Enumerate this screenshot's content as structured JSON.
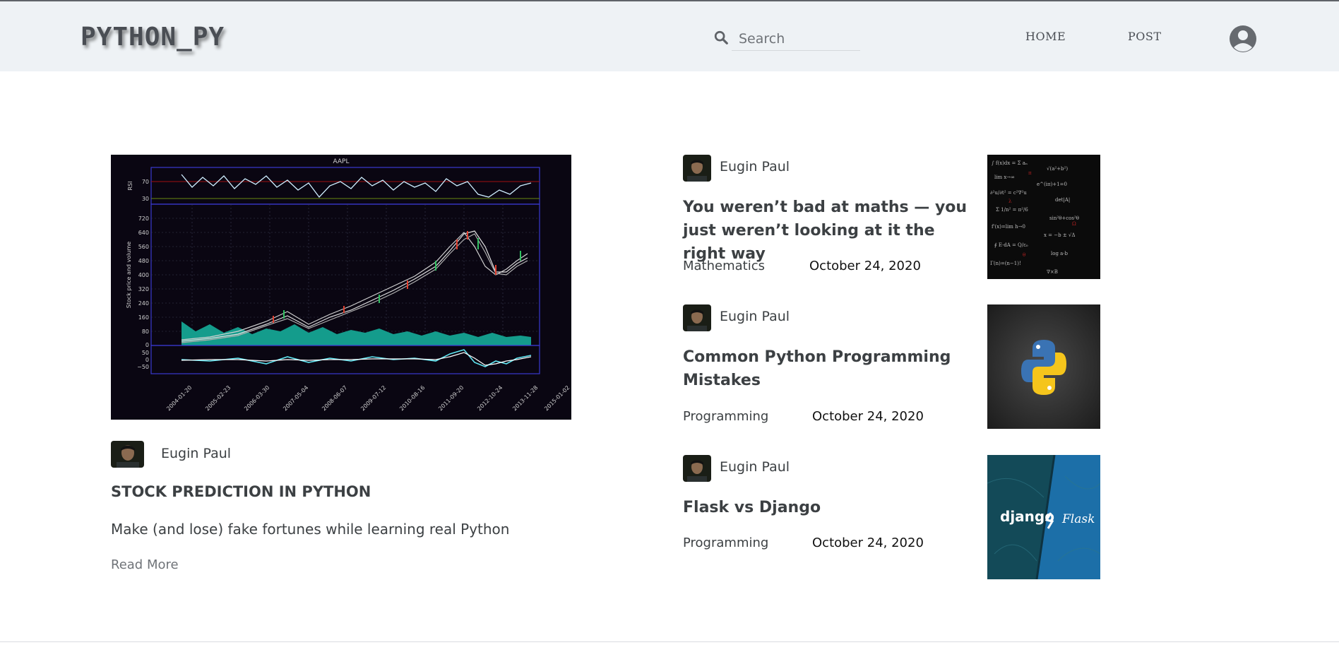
{
  "header": {
    "logo": "PYTHON_PY",
    "search_placeholder": "Search",
    "nav": {
      "home": "HOME",
      "post": "POST"
    }
  },
  "featured": {
    "chart_title": "AAPL",
    "author": "Eugin Paul",
    "title": "STOCK PREDICTION IN PYTHON",
    "subtitle": "Make (and lose) fake fortunes while learning real Python",
    "read_more": "Read More"
  },
  "posts": [
    {
      "author": "Eugin Paul",
      "title": "You weren’t bad at maths — you just weren’t looking at it the right way",
      "category": "Mathematics",
      "date": "October 24, 2020"
    },
    {
      "author": "Eugin Paul",
      "title": "Common Python Programming Mistakes",
      "category": "Programming",
      "date": "October 24, 2020"
    },
    {
      "author": "Eugin Paul",
      "title": "Flask vs Django",
      "category": "Programming",
      "date": "October 24, 2020",
      "thumb_labels": {
        "left": "django",
        "right": "Flask"
      }
    }
  ],
  "colors": {
    "header_bg": "#eef2f5",
    "text": "#3c4043",
    "chart_bg": "#0a0612"
  }
}
